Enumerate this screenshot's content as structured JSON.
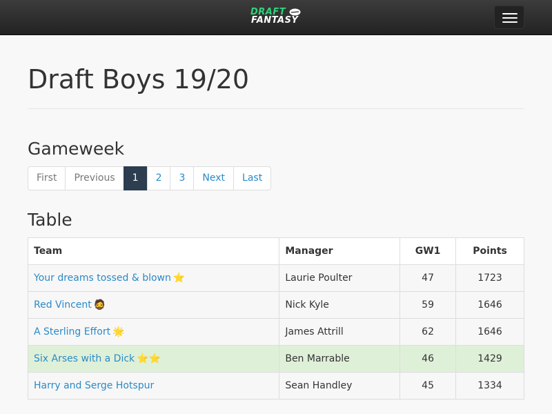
{
  "brand": {
    "line1": "DRAFT",
    "line2": "FANTASY"
  },
  "page": {
    "title": "Draft Boys 19/20"
  },
  "gameweek": {
    "heading": "Gameweek",
    "pages": [
      {
        "label": "First",
        "state": "muted"
      },
      {
        "label": "Previous",
        "state": "muted"
      },
      {
        "label": "1",
        "state": "active"
      },
      {
        "label": "2",
        "state": "link"
      },
      {
        "label": "3",
        "state": "link"
      },
      {
        "label": "Next",
        "state": "link"
      },
      {
        "label": "Last",
        "state": "link"
      }
    ]
  },
  "table": {
    "heading": "Table",
    "columns": [
      "Team",
      "Manager",
      "GW1",
      "Points"
    ],
    "rows": [
      {
        "team": "Your dreams tossed & blown",
        "emoji": "⭐",
        "manager": "Laurie Poulter",
        "gw": "47",
        "points": "1723",
        "highlight": false
      },
      {
        "team": "Red Vincent",
        "emoji": "🧔",
        "manager": "Nick Kyle",
        "gw": "59",
        "points": "1646",
        "highlight": false
      },
      {
        "team": "A Sterling Effort",
        "emoji": "🌟",
        "manager": "James Attrill",
        "gw": "62",
        "points": "1646",
        "highlight": false
      },
      {
        "team": "Six Arses with a Dick",
        "emoji": "⭐⭐",
        "manager": "Ben Marrable",
        "gw": "46",
        "points": "1429",
        "highlight": true
      },
      {
        "team": "Harry and Serge Hotspur",
        "emoji": "",
        "manager": "Sean Handley",
        "gw": "45",
        "points": "1334",
        "highlight": false
      }
    ]
  },
  "colors": {
    "link": "#2a8ac8",
    "active_page": "#2c3e50",
    "highlight_row": "#dff0d8",
    "brand_green": "#2fd37a"
  }
}
